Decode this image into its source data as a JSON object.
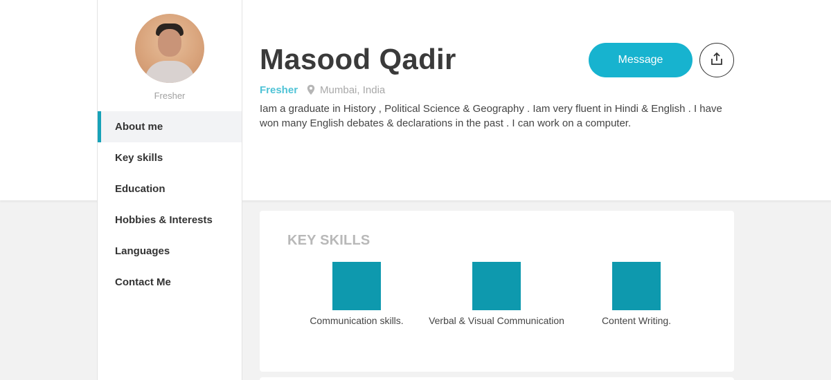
{
  "profile": {
    "name": "Masood Qadir",
    "role": "Fresher",
    "status": "Fresher",
    "location": "Mumbai, India",
    "bio": "Iam a graduate in History , Political Science & Geography . Iam very fluent in Hindi & English . I have won many English debates & declarations in the past . I can work on a computer."
  },
  "actions": {
    "message_label": "Message",
    "share_icon": "share-upload-icon"
  },
  "sidebar": {
    "items": [
      {
        "label": "About me",
        "active": true
      },
      {
        "label": "Key skills",
        "active": false
      },
      {
        "label": "Education",
        "active": false
      },
      {
        "label": "Hobbies & Interests",
        "active": false
      },
      {
        "label": "Languages",
        "active": false
      },
      {
        "label": "Contact Me",
        "active": false
      }
    ]
  },
  "key_skills": {
    "title": "KEY SKILLS",
    "items": [
      {
        "label": "Communication skills."
      },
      {
        "label": "Verbal & Visual Communication"
      },
      {
        "label": "Content Writing."
      }
    ]
  },
  "colors": {
    "accent": "#17b3cf",
    "tile": "#0e99ae",
    "status": "#4fc3d6"
  }
}
